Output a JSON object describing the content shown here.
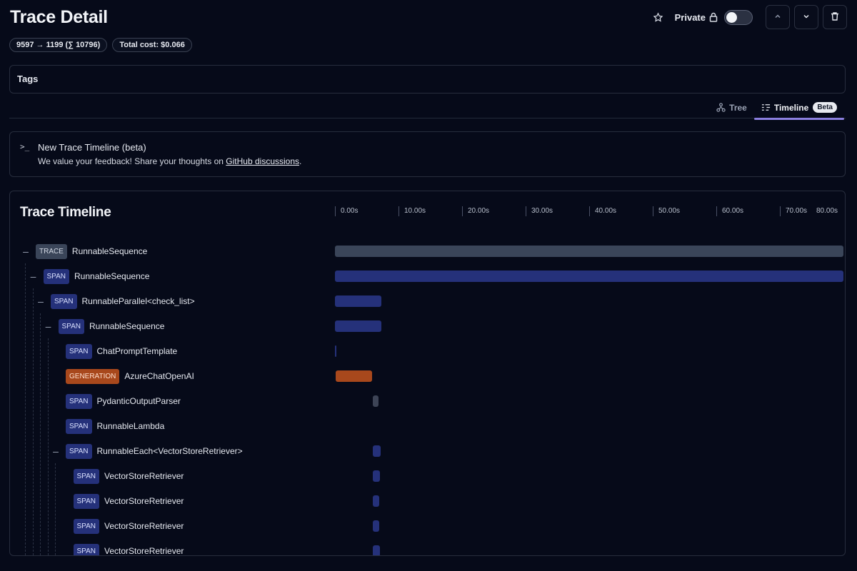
{
  "header": {
    "title": "Trace Detail",
    "private_label": "Private"
  },
  "badges": {
    "tokens": "9597 → 1199 (∑ 10796)",
    "cost": "Total cost: $0.066"
  },
  "tags": {
    "label": "Tags"
  },
  "tabs": {
    "tree": "Tree",
    "timeline": "Timeline",
    "beta": "Beta",
    "active": "timeline"
  },
  "alert": {
    "title": "New Trace Timeline (beta)",
    "text_before": "We value your feedback! Share your thoughts on",
    "link": "GitHub discussions",
    "text_after": "."
  },
  "timeline": {
    "title": "Trace Timeline",
    "max_seconds": 80,
    "ticks": [
      "0.00s",
      "10.00s",
      "20.00s",
      "30.00s",
      "40.00s",
      "50.00s",
      "60.00s",
      "70.00s"
    ],
    "end_label": "80.00s",
    "colors": {
      "trace": "#3a4559",
      "span": "#25317a",
      "generation": "#a8481c",
      "parser": "#3d4456"
    },
    "rows": [
      {
        "type": "TRACE",
        "name": "RunnableSequence",
        "depth": 0,
        "collapsible": true,
        "start_s": 0,
        "duration_s": 80
      },
      {
        "type": "SPAN",
        "name": "RunnableSequence",
        "depth": 1,
        "collapsible": true,
        "start_s": 0,
        "duration_s": 80
      },
      {
        "type": "SPAN",
        "name": "RunnableParallel<check_list>",
        "depth": 2,
        "collapsible": true,
        "start_s": 0,
        "duration_s": 7.3
      },
      {
        "type": "SPAN",
        "name": "RunnableSequence",
        "depth": 3,
        "collapsible": true,
        "start_s": 0,
        "duration_s": 7.3
      },
      {
        "type": "SPAN",
        "name": "ChatPromptTemplate",
        "depth": 4,
        "collapsible": false,
        "start_s": 0,
        "duration_s": 0.1
      },
      {
        "type": "GENERATION",
        "name": "AzureChatOpenAI",
        "depth": 4,
        "collapsible": false,
        "start_s": 0.1,
        "duration_s": 5.8
      },
      {
        "type": "SPAN",
        "name": "PydanticOutputParser",
        "depth": 4,
        "collapsible": false,
        "start_s": 5.9,
        "duration_s": 0.9
      },
      {
        "type": "SPAN",
        "name": "RunnableLambda",
        "depth": 4,
        "collapsible": false,
        "start_s": 5.9,
        "duration_s": 0
      },
      {
        "type": "SPAN",
        "name": "RunnableEach<VectorStoreRetriever>",
        "depth": 4,
        "collapsible": true,
        "start_s": 5.9,
        "duration_s": 1.3
      },
      {
        "type": "SPAN",
        "name": "VectorStoreRetriever",
        "depth": 5,
        "collapsible": false,
        "start_s": 5.9,
        "duration_s": 1.2
      },
      {
        "type": "SPAN",
        "name": "VectorStoreRetriever",
        "depth": 5,
        "collapsible": false,
        "start_s": 5.9,
        "duration_s": 1.1
      },
      {
        "type": "SPAN",
        "name": "VectorStoreRetriever",
        "depth": 5,
        "collapsible": false,
        "start_s": 5.9,
        "duration_s": 1.1
      },
      {
        "type": "SPAN",
        "name": "VectorStoreRetriever",
        "depth": 5,
        "collapsible": false,
        "start_s": 5.9,
        "duration_s": 1.2
      }
    ]
  }
}
